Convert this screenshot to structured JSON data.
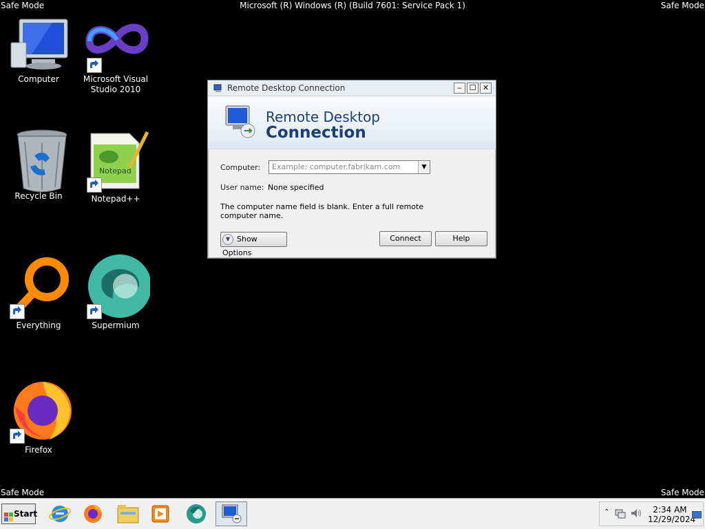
{
  "screen": {
    "safe_mode": "Safe Mode",
    "title": "Microsoft (R) Windows (R) (Build 7601: Service Pack 1)"
  },
  "desktop": {
    "icons": [
      {
        "label": "Computer",
        "icon": "computer-icon"
      },
      {
        "label": "Microsoft Visual Studio 2010",
        "icon": "visual-studio-icon"
      },
      {
        "label": "Recycle Bin",
        "icon": "recycle-bin-icon"
      },
      {
        "label": "Notepad++",
        "icon": "notepad-plus-plus-icon"
      },
      {
        "label": "Everything",
        "icon": "everything-search-icon"
      },
      {
        "label": "Supermium",
        "icon": "supermium-icon"
      },
      {
        "label": "Firefox",
        "icon": "firefox-icon"
      }
    ]
  },
  "dialog": {
    "window_title": "Remote Desktop Connection",
    "banner_line1": "Remote Desktop",
    "banner_line2": "Connection",
    "computer_label": "Computer:",
    "computer_placeholder": "Example: computer.fabrikam.com",
    "username_label": "User name:",
    "username_value": "None specified",
    "message": "The computer name field is blank. Enter a full remote computer name.",
    "show_options": "Show Options",
    "connect": "Connect",
    "help": "Help"
  },
  "taskbar": {
    "start": "Start",
    "apps": [
      "internet-explorer-icon",
      "firefox-icon",
      "file-explorer-icon",
      "media-player-icon",
      "supermium-icon",
      "remote-desktop-icon"
    ],
    "time": "2:34 AM",
    "date": "12/29/2024"
  },
  "colors": {
    "banner_text": "#1a3e78",
    "desktop_bg": "#000000"
  }
}
